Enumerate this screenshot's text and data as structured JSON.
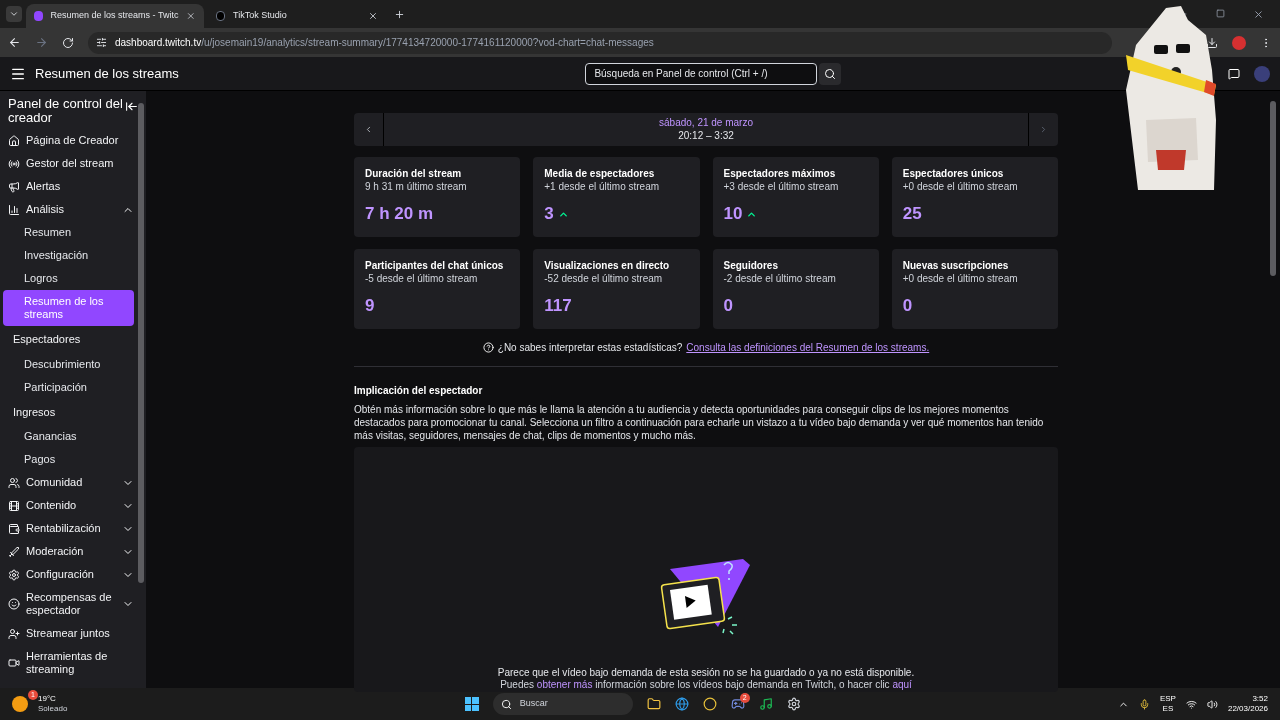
{
  "browser": {
    "tabs": [
      {
        "label": "Resumen de los streams - Twitc",
        "selected": true
      },
      {
        "label": "TikTok Studio",
        "selected": false
      }
    ],
    "url_host": "dashboard.twitch.tv",
    "url_path": "/u/josemain19/analytics/stream-summary/1774134720000-1774161120000?vod-chart=chat-messages"
  },
  "header": {
    "title": "Resumen de los streams",
    "search": {
      "placeholder": "Búsqueda en Panel de control (Ctrl + /)"
    }
  },
  "sidebar": {
    "title": "Panel de control del creador",
    "items": [
      {
        "label": "Página de Creador",
        "kind": "section"
      },
      {
        "label": "Gestor del stream",
        "kind": "section"
      },
      {
        "label": "Alertas",
        "kind": "section"
      },
      {
        "label": "Análisis",
        "kind": "section",
        "expanded": true,
        "children": [
          {
            "label": "Resumen",
            "kind": "sub",
            "selected": false
          },
          {
            "label": "Investigación",
            "kind": "sub",
            "selected": false
          },
          {
            "label": "Logros",
            "kind": "sub",
            "selected": false
          },
          {
            "label": "Resumen de los streams",
            "kind": "sub",
            "selected": true
          },
          {
            "label": "Espectadores",
            "kind": "group",
            "children": [
              {
                "label": "Descubrimiento",
                "kind": "sub",
                "selected": false
              },
              {
                "label": "Participación",
                "kind": "sub",
                "selected": false
              }
            ]
          },
          {
            "label": "Ingresos",
            "kind": "group",
            "children": [
              {
                "label": "Ganancias",
                "kind": "sub",
                "selected": false
              },
              {
                "label": "Pagos",
                "kind": "sub",
                "selected": false
              }
            ]
          }
        ]
      },
      {
        "label": "Comunidad",
        "kind": "section",
        "expanded": false
      },
      {
        "label": "Contenido",
        "kind": "section",
        "expanded": false
      },
      {
        "label": "Rentabilización",
        "kind": "section",
        "expanded": false
      },
      {
        "label": "Moderación",
        "kind": "section",
        "expanded": false
      },
      {
        "label": "Configuración",
        "kind": "section",
        "expanded": false
      },
      {
        "label": "Recompensas de espectador",
        "kind": "section",
        "expanded": false
      },
      {
        "label": "Streamear juntos",
        "kind": "section"
      },
      {
        "label": "Herramientas de streaming",
        "kind": "section"
      }
    ]
  },
  "date_bar": {
    "date": "sábado, 21 de marzo",
    "time": "20:12 – 3:32"
  },
  "stats": [
    {
      "title": "Duración del stream",
      "delta": "9 h 31 m último stream",
      "value": "7 h 20 m",
      "trend_up": false
    },
    {
      "title": "Media de espectadores",
      "delta": "+1 desde el último stream",
      "value": "3",
      "trend_up": true
    },
    {
      "title": "Espectadores máximos",
      "delta": "+3 desde el último stream",
      "value": "10",
      "trend_up": true
    },
    {
      "title": "Espectadores únicos",
      "delta": "+0 desde el último stream",
      "value": "25",
      "trend_up": false
    },
    {
      "title": "Participantes del chat únicos",
      "delta": "-5 desde el último stream",
      "value": "9",
      "trend_up": false
    },
    {
      "title": "Visualizaciones en directo",
      "delta": "-52 desde el último stream",
      "value": "117",
      "trend_up": false
    },
    {
      "title": "Seguidores",
      "delta": "-2 desde el último stream",
      "value": "0",
      "trend_up": false
    },
    {
      "title": "Nuevas suscripciones",
      "delta": "+0 desde el último stream",
      "value": "0",
      "trend_up": false
    }
  ],
  "help": {
    "text": "¿No sabes interpretar estas estadísticas?",
    "link": "Consulta las definiciones del Resumen de los streams."
  },
  "engagement": {
    "title": "Implicación del espectador",
    "text": "Obtén más información sobre lo que más le llama la atención a tu audiencia y detecta oportunidades para conseguir clips de los mejores momentos destacados para promocionar tu canal. Selecciona un filtro a continuación para echarle un vistazo a tu vídeo bajo demanda y ver qué momentos han tenido más visitas, seguidores, mensajes de chat, clips de momentos y mucho más.",
    "empty_message": "Parece que el vídeo bajo demanda de esta sesión no se ha guardado o ya no está disponible.",
    "more_prefix": "Puedes",
    "more_link": "obtener más",
    "more_middle": "información sobre los vídeos bajo demanda en Twitch, o hacer clic",
    "more_link2": "aquí"
  },
  "taskbar": {
    "temperature": "19°C",
    "weather": "Soleado",
    "weather_badge": "1",
    "search": "Buscar",
    "discord_badge": "2",
    "lang": "ESP",
    "lang_sub": "ES",
    "time": "3:52",
    "date": "22/03/2026"
  }
}
